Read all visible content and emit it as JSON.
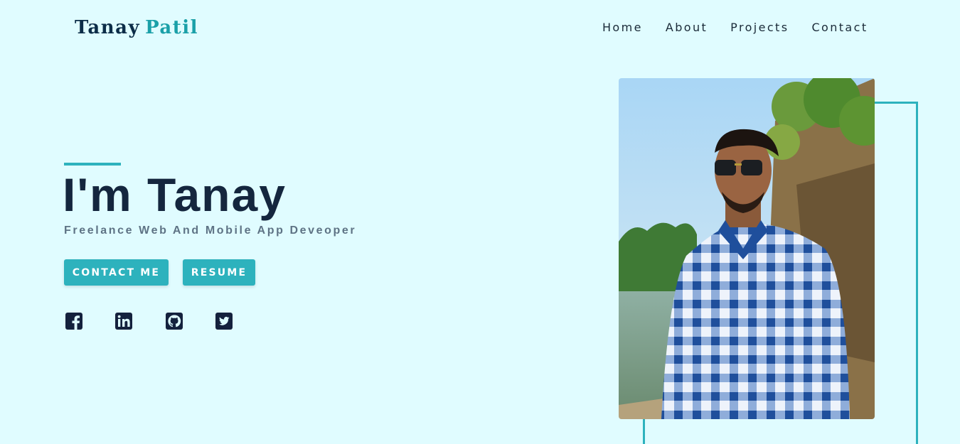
{
  "brand": {
    "first": "Tanay",
    "last": "Patil"
  },
  "nav": {
    "items": [
      "Home",
      "About",
      "Projects",
      "Contact"
    ]
  },
  "hero": {
    "title": "I'm Tanay",
    "subtitle": "Freelance Web And Mobile App Deveoper",
    "contact_label": "CONTACT ME",
    "resume_label": "RESUME"
  },
  "social": [
    "facebook-icon",
    "linkedin-icon",
    "github-icon",
    "twitter-icon"
  ],
  "colors": {
    "background": "#e0fcff",
    "accent": "#2db2bd",
    "heading": "#14263e",
    "brand_dark": "#0c2d48"
  }
}
